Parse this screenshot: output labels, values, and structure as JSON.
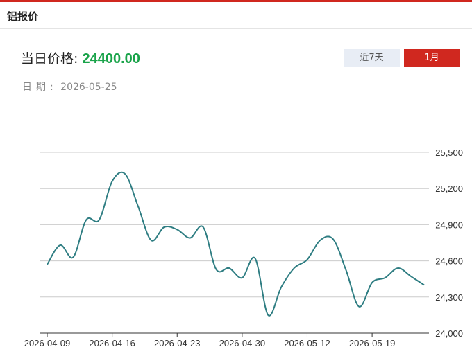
{
  "panel": {
    "title": "铝报价"
  },
  "quote": {
    "label": "当日价格:",
    "value": "24400.00",
    "date_label": "日期:",
    "date": "2026-05-25"
  },
  "range_tabs": [
    {
      "label": "近7天",
      "active": false
    },
    {
      "label": "1月",
      "active": true
    }
  ],
  "colors": {
    "accent": "#d0281f",
    "price": "#1aa34a",
    "line": "#2e7d82",
    "grid": "#cccccc"
  },
  "chart_data": {
    "type": "line",
    "title": "",
    "xlabel": "",
    "ylabel": "",
    "ylim": [
      24000,
      25500
    ],
    "yticks": [
      24000,
      24300,
      24600,
      24900,
      25200,
      25500
    ],
    "ytick_labels": [
      "24,000",
      "24,300",
      "24,600",
      "24,900",
      "25,200",
      "25,500"
    ],
    "xtick_labels": [
      "2026-04-09",
      "2026-04-16",
      "2026-04-23",
      "2026-04-30",
      "2026-05-12",
      "2026-05-19"
    ],
    "xtick_index": [
      0,
      5,
      10,
      15,
      20,
      25
    ],
    "grid": true,
    "legend": "none",
    "series": [
      {
        "x": [
          "2026-04-09",
          "2026-04-10",
          "2026-04-13",
          "2026-04-14",
          "2026-04-15",
          "2026-04-16",
          "2026-04-17",
          "2026-04-20",
          "2026-04-21",
          "2026-04-22",
          "2026-04-23",
          "2026-04-24",
          "2026-04-27",
          "2026-04-28",
          "2026-04-29",
          "2026-04-30",
          "2026-05-06",
          "2026-05-07",
          "2026-05-08",
          "2026-05-11",
          "2026-05-12",
          "2026-05-13",
          "2026-05-14",
          "2026-05-15",
          "2026-05-18",
          "2026-05-19",
          "2026-05-20",
          "2026-05-21",
          "2026-05-22",
          "2026-05-25"
        ],
        "values": [
          24570,
          24730,
          24630,
          24940,
          24940,
          25260,
          25320,
          25050,
          24770,
          24880,
          24860,
          24790,
          24880,
          24530,
          24540,
          24460,
          24620,
          24150,
          24380,
          24540,
          24610,
          24770,
          24780,
          24520,
          24220,
          24420,
          24460,
          24540,
          24470,
          24400
        ]
      }
    ]
  }
}
